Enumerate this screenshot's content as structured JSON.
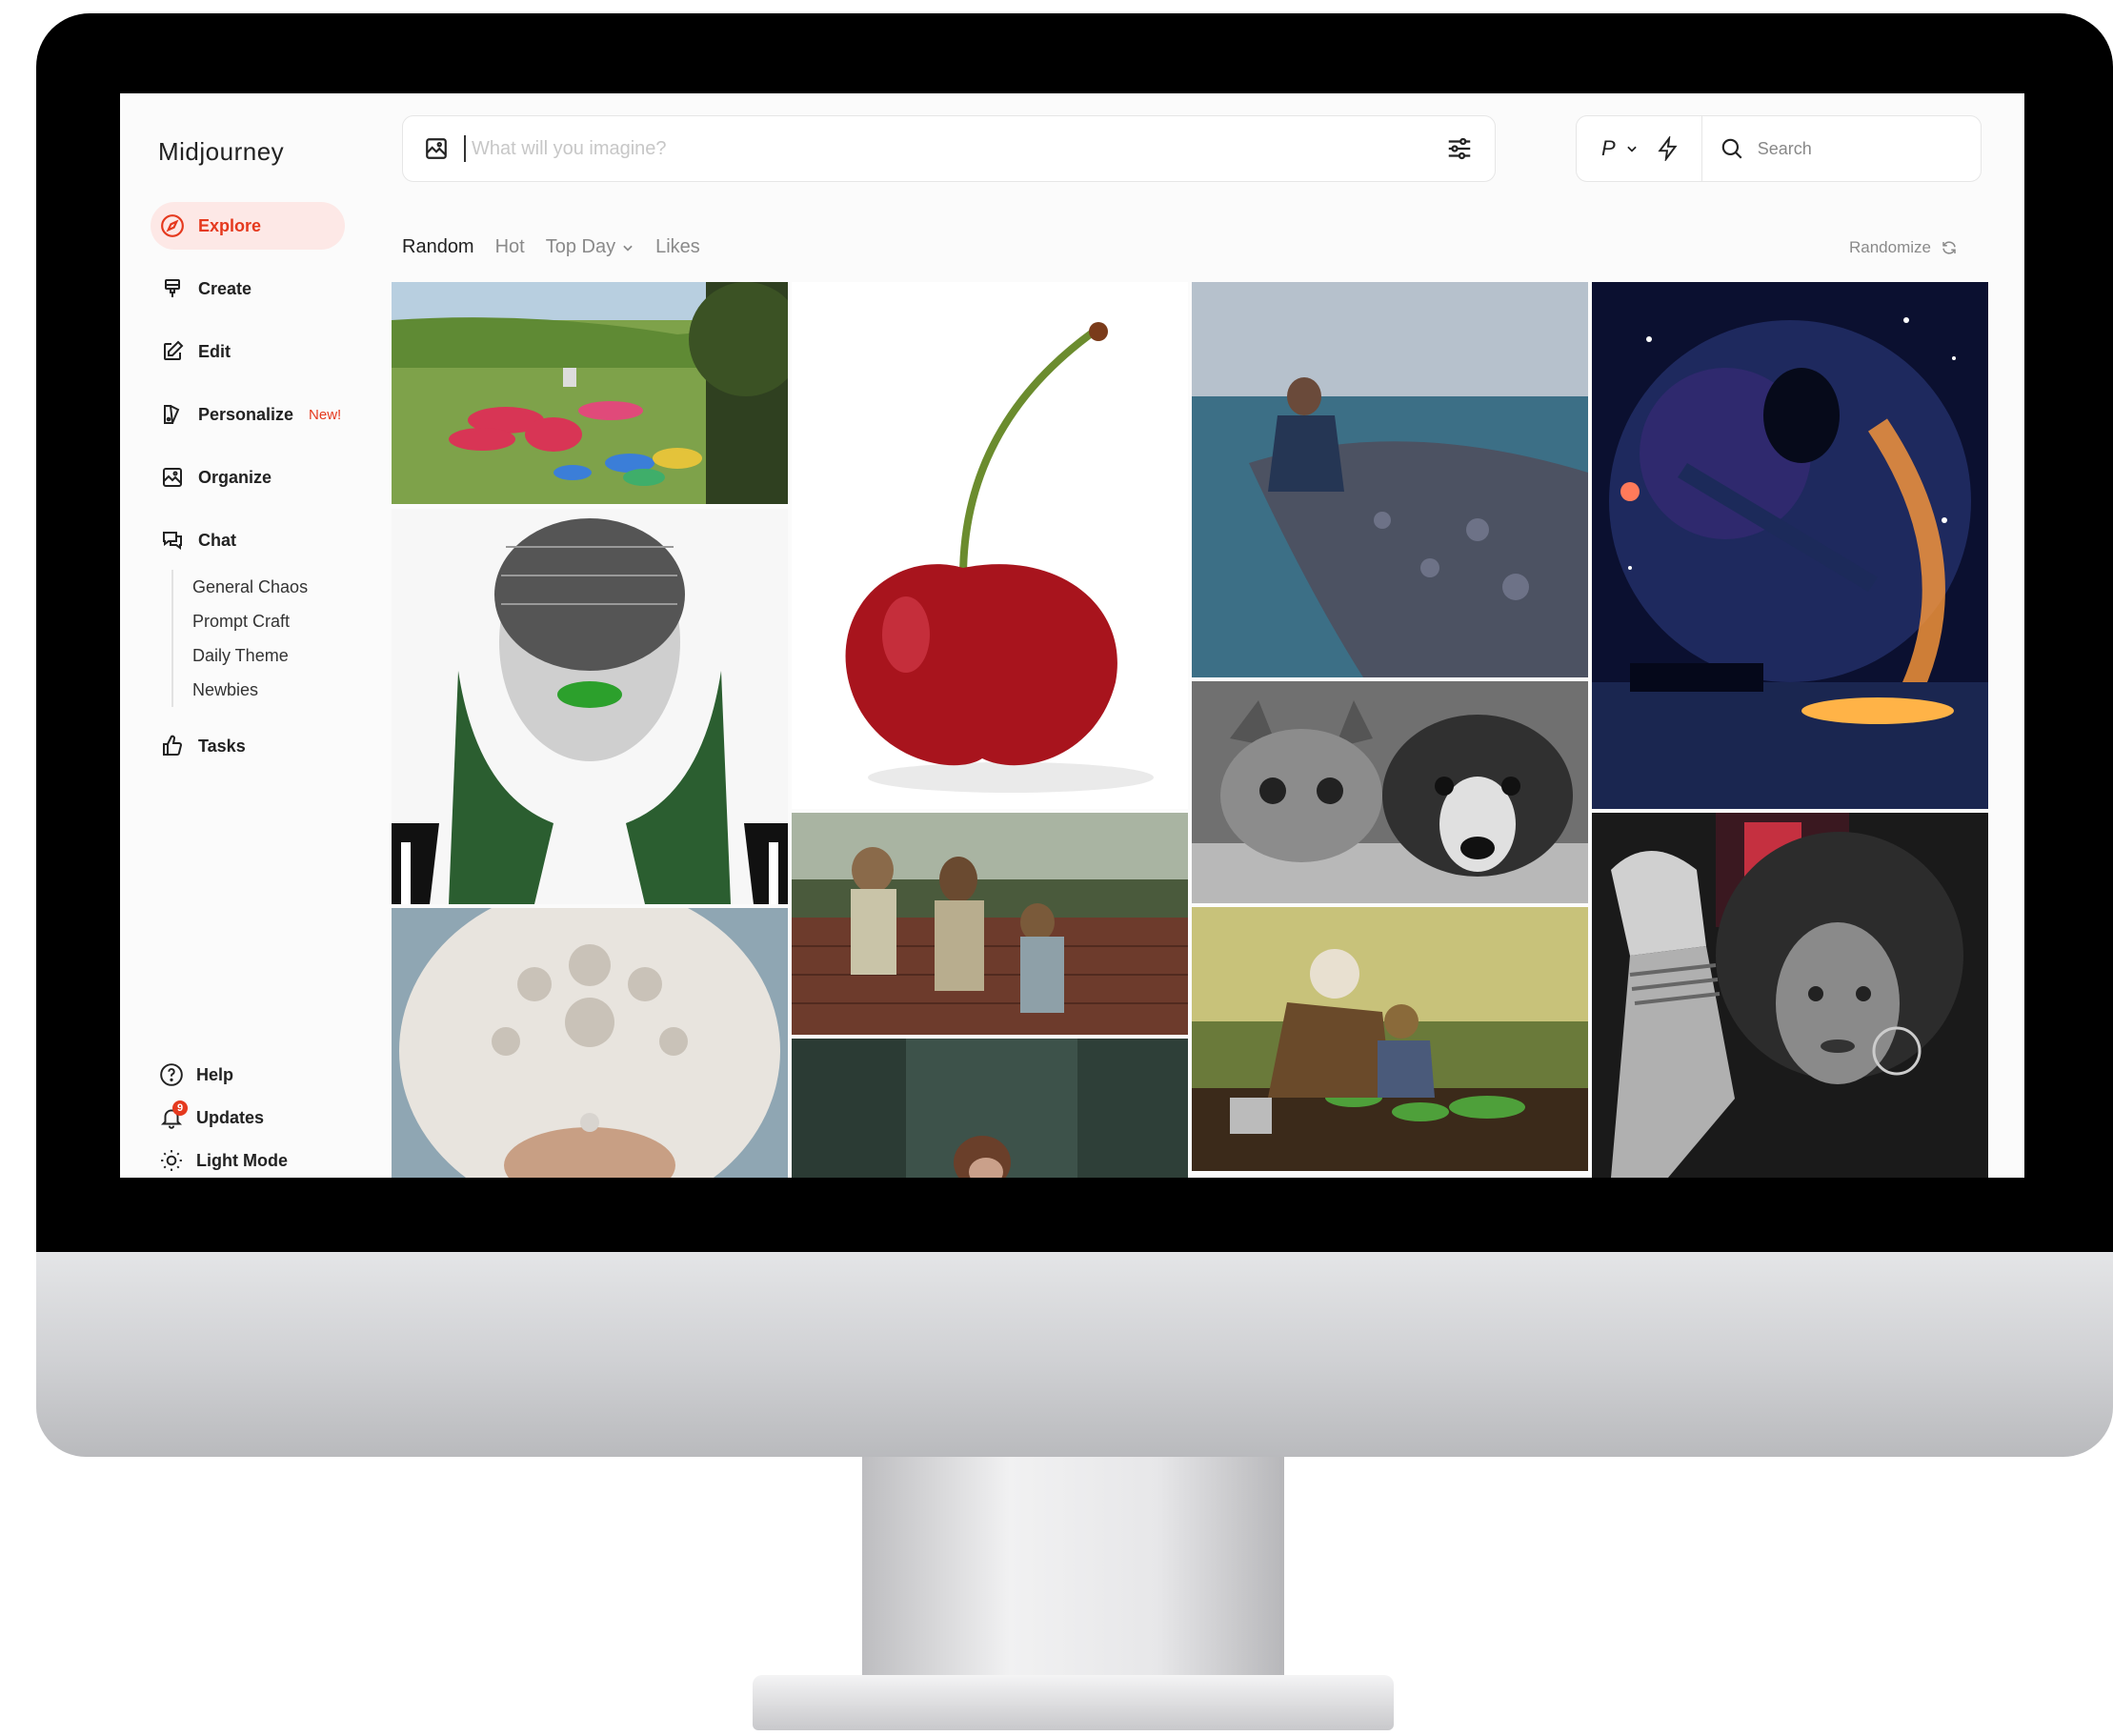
{
  "app": {
    "brand": "Midjourney"
  },
  "sidebar": {
    "nav": [
      {
        "label": "Explore",
        "icon": "compass-icon"
      },
      {
        "label": "Create",
        "icon": "paintbrush-icon"
      },
      {
        "label": "Edit",
        "icon": "edit-icon"
      },
      {
        "label": "Personalize",
        "icon": "personalize-icon",
        "badge": "New!"
      },
      {
        "label": "Organize",
        "icon": "image-gallery-icon"
      },
      {
        "label": "Chat",
        "icon": "chat-icon"
      }
    ],
    "chat_channels": [
      "General Chaos",
      "Prompt Craft",
      "Daily Theme",
      "Newbies"
    ],
    "tasks": {
      "label": "Tasks",
      "icon": "thumbs-up-icon"
    },
    "bottom": [
      {
        "label": "Help",
        "icon": "help-icon"
      },
      {
        "label": "Updates",
        "icon": "bell-icon",
        "count": "9"
      },
      {
        "label": "Light Mode",
        "icon": "sun-icon"
      }
    ]
  },
  "prompt": {
    "placeholder": "What will you imagine?"
  },
  "tools": {
    "personalize_toggle": "P",
    "search_placeholder": "Search"
  },
  "tabs": [
    {
      "label": "Random"
    },
    {
      "label": "Hot"
    },
    {
      "label": "Top Day"
    },
    {
      "label": "Likes"
    }
  ],
  "randomize_label": "Randomize",
  "colors": {
    "accent": "#e5391e",
    "accent_bg": "#fde8e6"
  }
}
